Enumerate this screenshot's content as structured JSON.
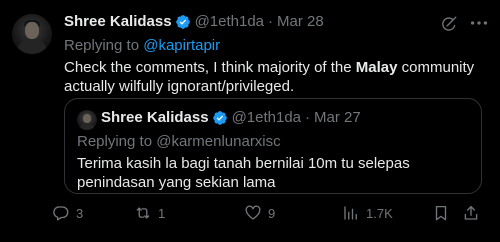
{
  "tweet": {
    "author": {
      "name": "Shree Kalidass",
      "handle": "@1eth1da",
      "separator": "·",
      "date": "Mar 28"
    },
    "replying_prefix": "Replying to ",
    "replying_to": "@kapirtapir",
    "text_before": "Check the comments, I think majority of the ",
    "text_bold": "Malay",
    "text_after": " community actually wilfully ignorant/privileged."
  },
  "quote": {
    "author": {
      "name": "Shree Kalidass",
      "handle": "@1eth1da",
      "separator": "·",
      "date": "Mar 27"
    },
    "replying_text": "Replying to @karmenlunarxisc",
    "text": "Terima kasih la bagi tanah bernilai 10m tu selepas penindasan yang sekian lama"
  },
  "actions": {
    "replies": "3",
    "reposts": "1",
    "likes": "9",
    "views": "1.7K"
  },
  "colors": {
    "background": "#000000",
    "text": "#e7e9ea",
    "muted": "#71767b",
    "accent": "#1d9bf0",
    "border": "#2f3336"
  },
  "icons": [
    "verified-badge-icon",
    "grok-icon",
    "more-icon",
    "reply-icon",
    "repost-icon",
    "like-icon",
    "views-icon",
    "bookmark-icon",
    "share-icon"
  ]
}
